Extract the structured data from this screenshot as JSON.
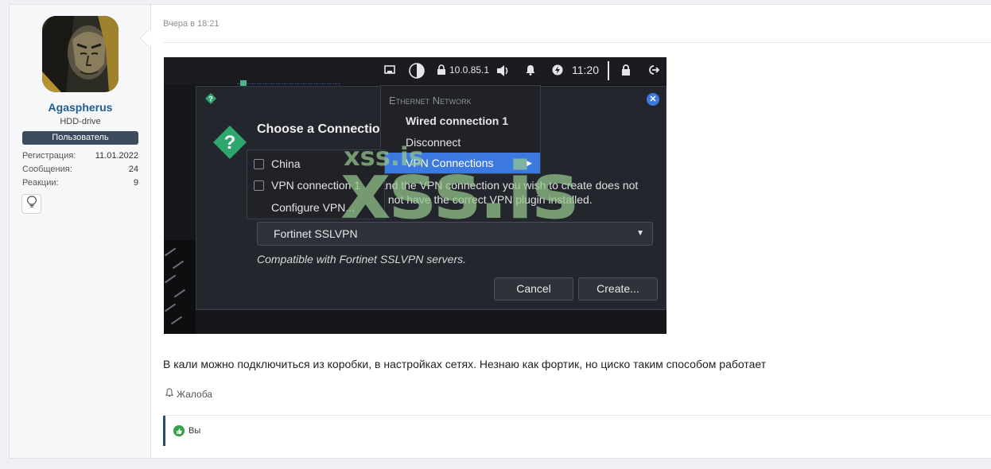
{
  "user": {
    "name": "Agaspherus",
    "title": "HDD-drive",
    "banner": "Пользователь",
    "stats": [
      {
        "label": "Регистрация:",
        "value": "11.01.2022"
      },
      {
        "label": "Сообщения:",
        "value": "24"
      },
      {
        "label": "Реакции:",
        "value": "9"
      }
    ],
    "trophy_icon": "lightbulb-icon"
  },
  "post": {
    "date": "Вчера в 18:21",
    "message": "В кали можно подключиться из коробки, в настройках сетях. Незнаю как фортик, но циско таким способом работает",
    "report_label": "Жалоба",
    "reaction_label": "Вы"
  },
  "screenshot": {
    "tray": {
      "ip": "10.0.85.1",
      "time": "11:20"
    },
    "dialog": {
      "title": "Choose a Connection",
      "text": "and the VPN connection you wish to create does not\ny not have the correct VPN plugin installed.",
      "select_value": "Fortinet SSLVPN",
      "compat_text": "Compatible with Fortinet SSLVPN servers.",
      "cancel_label": "Cancel",
      "create_label": "Create..."
    },
    "network_menu": {
      "header": "Ethernet Network",
      "items": [
        "Wired connection 1",
        "Disconnect",
        "VPN Connections"
      ]
    },
    "vpn_menu": {
      "items": [
        "China",
        "VPN connection 1",
        "Configure VPN..."
      ]
    },
    "watermark": "xss.is",
    "watermark_small": "xss.is"
  },
  "colors": {
    "username": "#1f5d8f",
    "banner_bg": "#3b4a5c",
    "menu_highlight": "#3d7ae0",
    "reaction_green": "#3aa14a"
  }
}
